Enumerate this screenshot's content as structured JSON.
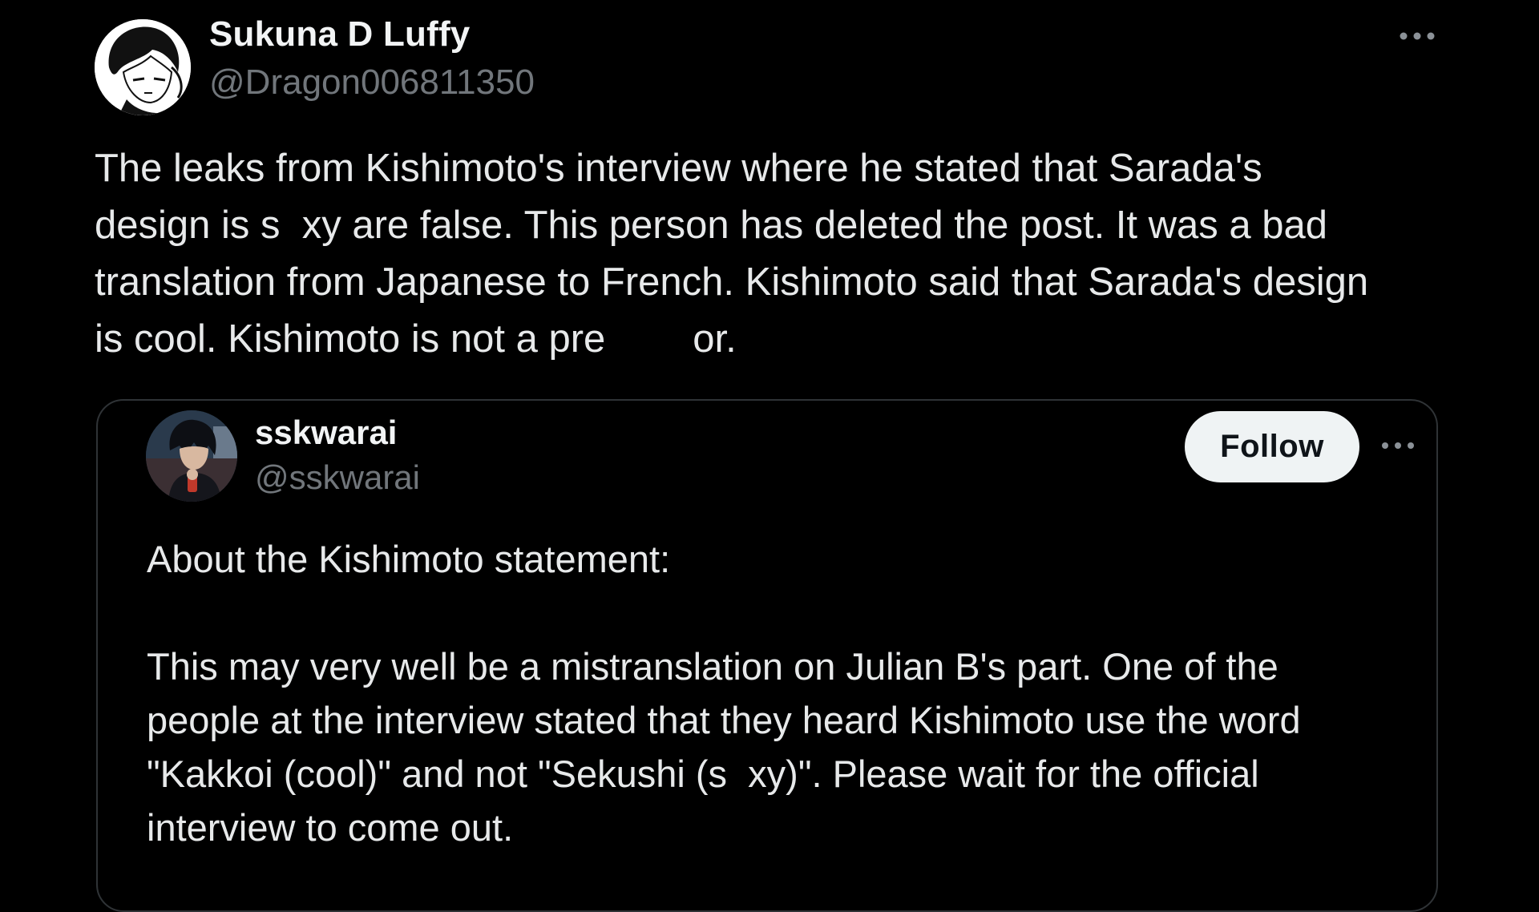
{
  "author": {
    "display_name": "Sukuna D Luffy",
    "handle": "@Dragon006811350",
    "avatar_icon": "manga-character-avatar"
  },
  "post": {
    "lines": [
      "The leaks from Kishimoto's interview where he stated that Sarada's",
      "design is s  xy are false. This person has deleted the post. It was a bad",
      "translation from Japanese to French. Kishimoto said that Sarada's design",
      "is cool. Kishimoto is not a pre        or."
    ]
  },
  "quoted": {
    "display_name": "sskwarai",
    "handle": "@sskwarai",
    "avatar_icon": "anime-character-avatar",
    "follow_label": "Follow",
    "lines_1": [
      "About the Kishimoto statement:"
    ],
    "lines_2": [
      "This may very well be a mistranslation on Julian B's part. One of the",
      "people at the interview stated that they heard Kishimoto use the word",
      "\"Kakkoi (cool)\" and not \"Sekushi (s  xy)\". Please wait for the official",
      "interview to come out."
    ]
  },
  "colors": {
    "background": "#000000",
    "text_primary": "#e7e9ea",
    "text_secondary": "#71767b",
    "card_border": "#2f3336",
    "follow_bg": "#eff3f4",
    "follow_text": "#0f1419"
  }
}
